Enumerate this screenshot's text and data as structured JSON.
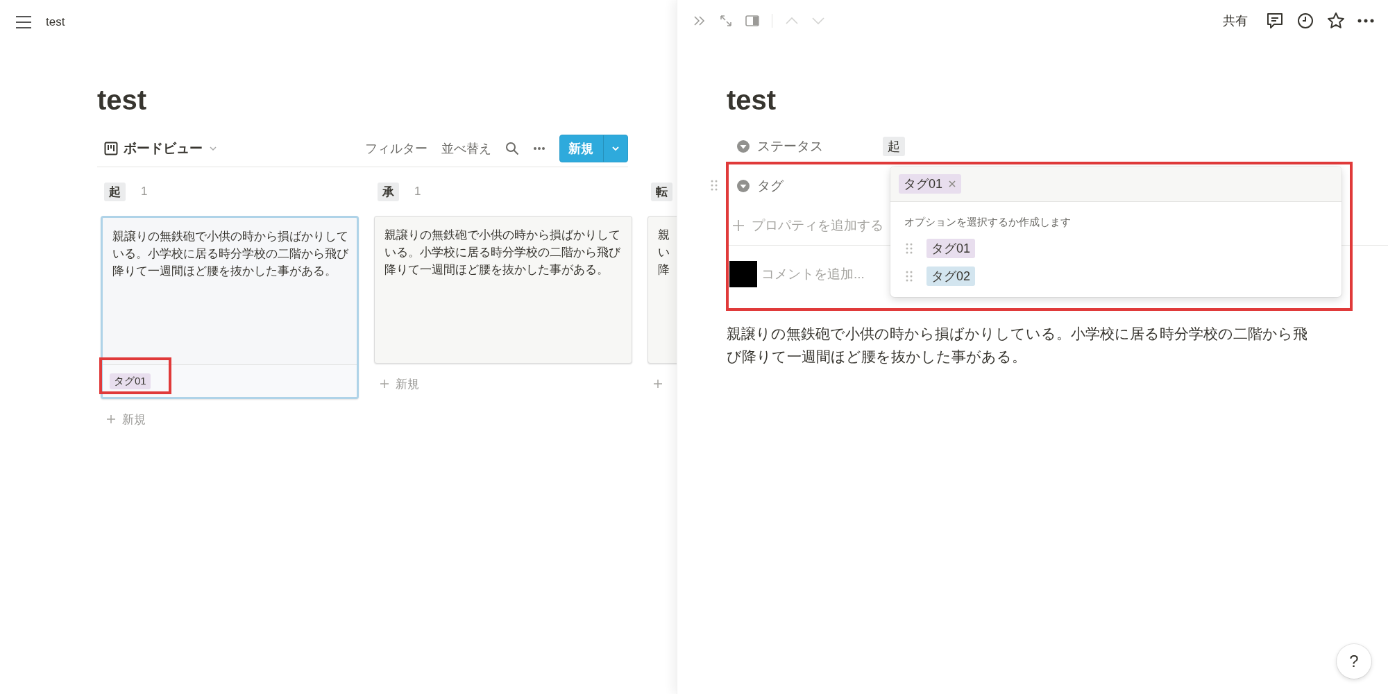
{
  "topbar": {
    "title": "test"
  },
  "board": {
    "title": "test",
    "view_label": "ボードビュー",
    "actions": [
      "フィルター",
      "並べ替え"
    ],
    "new_button": "新規",
    "columns": [
      {
        "name": "起",
        "count": "1",
        "add_label": "新規",
        "cards": [
          {
            "selected": true,
            "lines": [
              "親譲りの無鉄砲で小供の時から損ばかりして",
              "いる。小学校に居る時分学校の二階から飛び",
              "降りて一週間ほど腰を抜かした事がある。"
            ],
            "tags": [
              {
                "label": "タグ01",
                "color": "#e8deee"
              }
            ]
          }
        ]
      },
      {
        "name": "承",
        "count": "1",
        "add_label": "新規",
        "cards": [
          {
            "selected": false,
            "lines": [
              "親譲りの無鉄砲で小供の時から損ばかりして",
              "いる。小学校に居る時分学校の二階から飛び",
              "降りて一週間ほど腰を抜かした事がある。"
            ]
          }
        ]
      },
      {
        "name": "転",
        "cards": [
          {
            "selected": false,
            "lines": [
              "親",
              "い",
              "降"
            ]
          }
        ]
      }
    ]
  },
  "peek": {
    "share": "共有",
    "title": "test",
    "properties": [
      {
        "kind": "select",
        "name": "ステータス",
        "value": "起"
      },
      {
        "kind": "multi_select",
        "name": "タグ"
      }
    ],
    "add_property": "プロパティを追加する",
    "comment_placeholder": "コメントを追加...",
    "body": "親譲りの無鉄砲で小供の時から損ばかりしている。小学校に居る時分学校の二階から飛び降りて一週間ほど腰を抜かした事がある。",
    "dropdown": {
      "selected_tags": [
        {
          "label": "タグ01",
          "color": "#e8deee"
        }
      ],
      "hint": "オプションを選択するか作成します",
      "options": [
        {
          "label": "タグ01",
          "color": "#e8deee"
        },
        {
          "label": "タグ02",
          "color": "#d3e5ef"
        }
      ]
    }
  },
  "help": "?"
}
